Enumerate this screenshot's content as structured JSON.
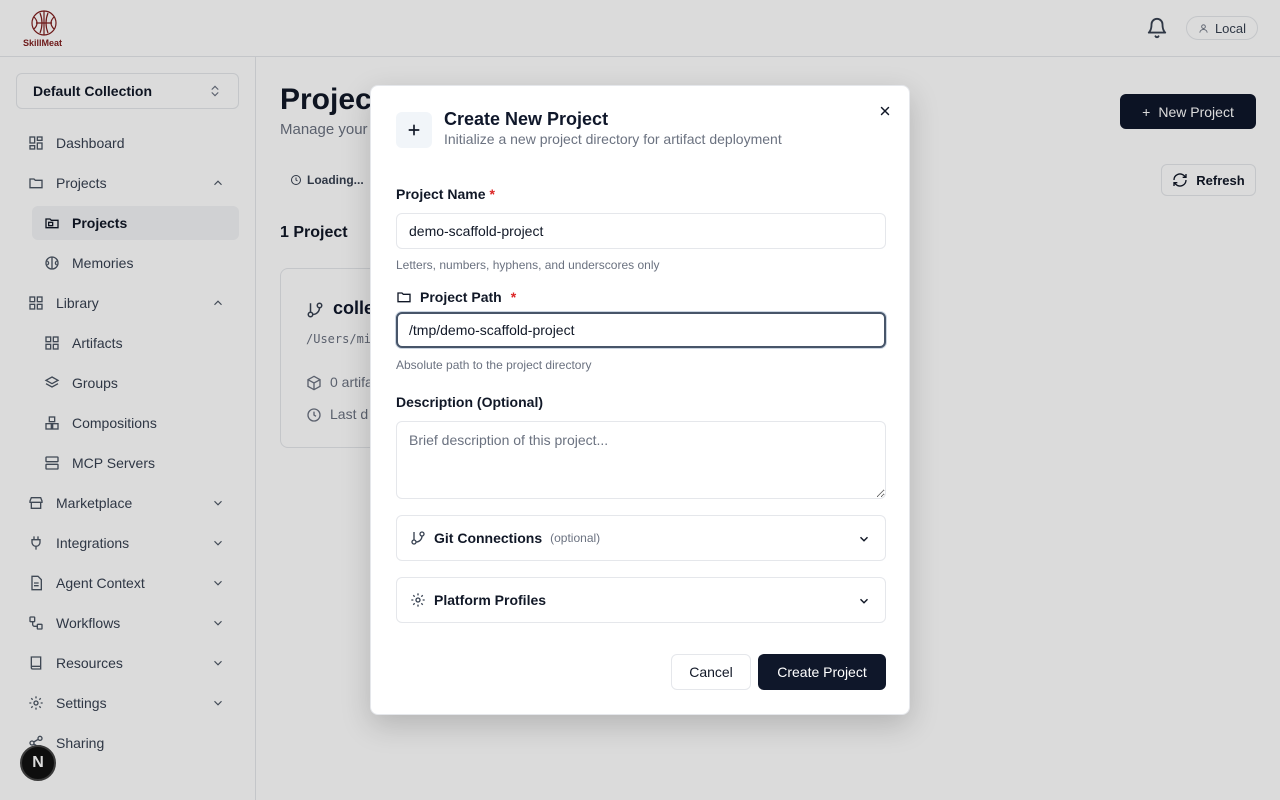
{
  "app": {
    "logo_text": "SkillMeat"
  },
  "topbar": {
    "user_label": "Local"
  },
  "sidebar": {
    "collection": "Default Collection",
    "items": [
      {
        "label": "Dashboard"
      },
      {
        "label": "Projects"
      },
      {
        "label": "Projects"
      },
      {
        "label": "Memories"
      },
      {
        "label": "Library"
      },
      {
        "label": "Artifacts"
      },
      {
        "label": "Groups"
      },
      {
        "label": "Compositions"
      },
      {
        "label": "MCP Servers"
      },
      {
        "label": "Marketplace"
      },
      {
        "label": "Integrations"
      },
      {
        "label": "Agent Context"
      },
      {
        "label": "Workflows"
      },
      {
        "label": "Resources"
      },
      {
        "label": "Settings"
      },
      {
        "label": "Sharing"
      }
    ],
    "badge": "N"
  },
  "main": {
    "title": "Projects",
    "subtitle": "Manage your",
    "new_project": "New Project",
    "loading": "Loading...",
    "refresh": "Refresh",
    "count": "1 Project",
    "card": {
      "name": "colle",
      "path": "/Users/mi",
      "artifacts": "0 artifa",
      "last": "Last d"
    }
  },
  "modal": {
    "title": "Create New Project",
    "description": "Initialize a new project directory for artifact deployment",
    "name_label": "Project Name",
    "required_mark": "*",
    "name_value": "demo-scaffold-project",
    "name_hint": "Letters, numbers, hyphens, and underscores only",
    "path_label": "Project Path",
    "path_value": "/tmp/demo-scaffold-project",
    "path_hint": "Absolute path to the project directory",
    "desc_label": "Description (Optional)",
    "desc_placeholder": "Brief description of this project...",
    "git_label": "Git Connections",
    "git_optional": "(optional)",
    "platform_label": "Platform Profiles",
    "cancel": "Cancel",
    "create": "Create Project"
  }
}
